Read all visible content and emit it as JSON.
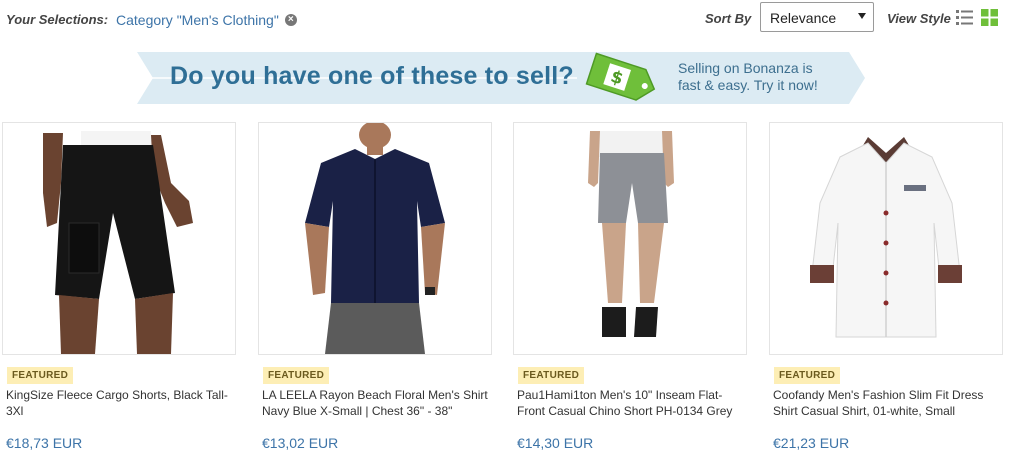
{
  "filters": {
    "selections_label": "Your Selections:",
    "chip_label": "Category \"Men's Clothing\"",
    "sort_label": "Sort By",
    "sort_value": "Relevance",
    "view_label": "View Style"
  },
  "banner": {
    "title": "Do you have one of these to sell?",
    "subtitle": "Selling on Bonanza is fast & easy. Try it now!"
  },
  "colors": {
    "link": "#3d74a8",
    "badge_bg": "#fdeeb5",
    "banner_bg": "#dcebf3",
    "tag_green": "#6fbf3a"
  },
  "products": [
    {
      "badge": "FEATURED",
      "title": "KingSize Fleece Cargo Shorts, Black Tall-3Xl",
      "price": "€18,73 EUR"
    },
    {
      "badge": "FEATURED",
      "title": "LA LEELA Rayon Beach Floral Men's Shirt Navy Blue X-Small | Chest 36\" - 38\"",
      "price": "€13,02 EUR"
    },
    {
      "badge": "FEATURED",
      "title": "Pau1Hami1ton Men's 10\" Inseam Flat-Front Casual Chino Short PH-0134 Grey",
      "price": "€14,30 EUR"
    },
    {
      "badge": "FEATURED",
      "title": "Coofandy Men's Fashion Slim Fit Dress Shirt Casual Shirt, 01-white, Small",
      "price": "€21,23 EUR"
    }
  ]
}
